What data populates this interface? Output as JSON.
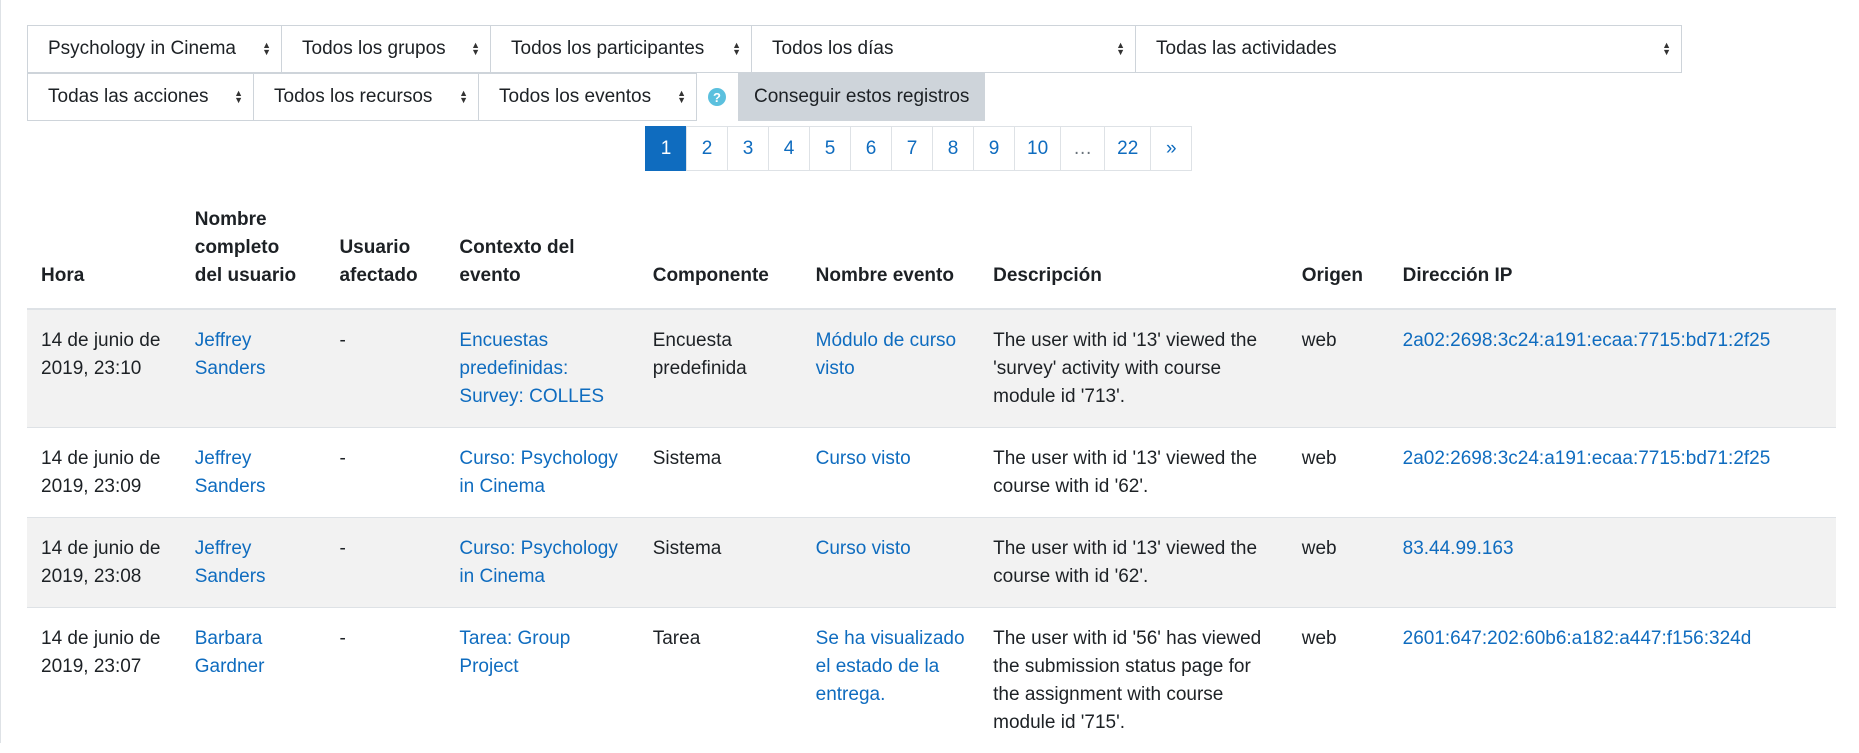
{
  "filters": {
    "row1": [
      {
        "label": "Psychology in Cinema",
        "width": 255
      },
      {
        "label": "Todos los grupos",
        "width": 210
      },
      {
        "label": "Todos los participantes",
        "width": 262
      },
      {
        "label": "Todos los días",
        "width": 385
      },
      {
        "label": "Todas las actividades",
        "width": 547
      }
    ],
    "row2": [
      {
        "label": "Todas las acciones",
        "width": 227
      },
      {
        "label": "Todos los recursos",
        "width": 226
      },
      {
        "label": "Todos los eventos",
        "width": 219
      }
    ],
    "help_icon": "question-circle-icon",
    "get_button": "Conseguir estos registros"
  },
  "pagination": [
    "1",
    "2",
    "3",
    "4",
    "5",
    "6",
    "7",
    "8",
    "9",
    "10",
    "…",
    "22",
    "»"
  ],
  "pagination_active": "1",
  "table": {
    "headers": [
      "Hora",
      "Nombre completo del usuario",
      "Usuario afectado",
      "Contexto del evento",
      "Componente",
      "Nombre evento",
      "Descripción",
      "Origen",
      "Dirección IP"
    ],
    "rows": [
      {
        "time": "14 de junio de 2019, 23:10",
        "user": "Jeffrey Sanders",
        "affected": "-",
        "context": "Encuestas predefinidas: Survey: COLLES",
        "component": "Encuesta predefinida",
        "event": "Módulo de curso visto",
        "description": "The user with id '13' viewed the 'survey' activity with course module id '713'.",
        "origin": "web",
        "ip": "2a02:2698:3c24:a191:ecaa:7715:bd71:2f25"
      },
      {
        "time": "14 de junio de 2019, 23:09",
        "user": "Jeffrey Sanders",
        "affected": "-",
        "context": "Curso: Psychology in Cinema",
        "component": "Sistema",
        "event": "Curso visto",
        "description": "The user with id '13' viewed the course with id '62'.",
        "origin": "web",
        "ip": "2a02:2698:3c24:a191:ecaa:7715:bd71:2f25"
      },
      {
        "time": "14 de junio de 2019, 23:08",
        "user": "Jeffrey Sanders",
        "affected": "-",
        "context": "Curso: Psychology in Cinema",
        "component": "Sistema",
        "event": "Curso visto",
        "description": "The user with id '13' viewed the course with id '62'.",
        "origin": "web",
        "ip": "83.44.99.163"
      },
      {
        "time": "14 de junio de 2019, 23:07",
        "user": "Barbara Gardner",
        "affected": "-",
        "context": "Tarea: Group Project",
        "component": "Tarea",
        "event": "Se ha visualizado el estado de la entrega.",
        "description": "The user with id '56' has viewed the submission status page for the assignment with course module id '715'.",
        "origin": "web",
        "ip": "2601:647:202:60b6:a182:a447:f156:324d"
      }
    ]
  },
  "colors": {
    "link": "#0f6cbf",
    "stripe": "#f2f2f2",
    "button": "#ced4da",
    "help": "#5bc0de"
  }
}
